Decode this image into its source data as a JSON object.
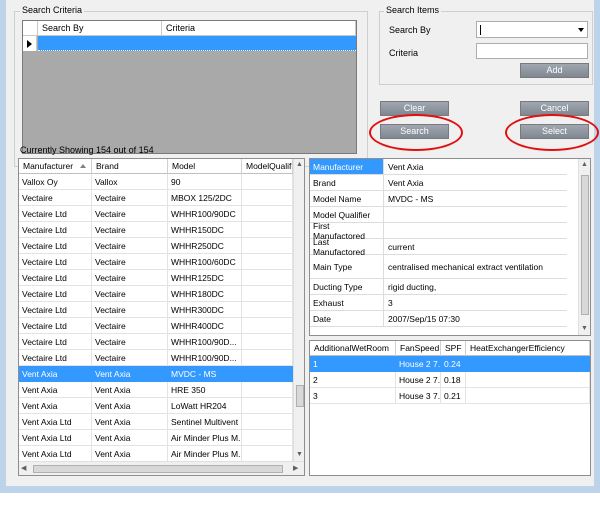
{
  "search_criteria": {
    "legend": "Search Criteria",
    "columns": [
      "Search By",
      "Criteria"
    ]
  },
  "search_items": {
    "legend": "Search Items",
    "search_by_label": "Search By",
    "criteria_label": "Criteria",
    "add_label": "Add"
  },
  "buttons": {
    "clear": "Clear",
    "cancel": "Cancel",
    "search": "Search",
    "select": "Select"
  },
  "status": "Currently Showing 154 out of 154",
  "list": {
    "columns": [
      "Manufacturer",
      "Brand",
      "Model",
      "ModelQualifie"
    ],
    "rows": [
      [
        "Vallox Oy",
        "Vallox",
        "90",
        ""
      ],
      [
        "Vectaire",
        "Vectaire",
        "MBOX 125/2DC",
        ""
      ],
      [
        "Vectaire Ltd",
        "Vectaire",
        "WHHR100/90DC",
        ""
      ],
      [
        "Vectaire Ltd",
        "Vectaire",
        "WHHR150DC",
        ""
      ],
      [
        "Vectaire Ltd",
        "Vectaire",
        "WHHR250DC",
        ""
      ],
      [
        "Vectaire Ltd",
        "Vectaire",
        "WHHR100/60DC",
        ""
      ],
      [
        "Vectaire Ltd",
        "Vectaire",
        "WHHR125DC",
        ""
      ],
      [
        "Vectaire Ltd",
        "Vectaire",
        "WHHR180DC",
        ""
      ],
      [
        "Vectaire Ltd",
        "Vectaire",
        "WHHR300DC",
        ""
      ],
      [
        "Vectaire Ltd",
        "Vectaire",
        "WHHR400DC",
        ""
      ],
      [
        "Vectaire Ltd",
        "Vectaire",
        "WHHR100/90D...",
        ""
      ],
      [
        "Vectaire Ltd",
        "Vectaire",
        "WHHR100/90D...",
        ""
      ],
      [
        "Vent Axia",
        "Vent Axia",
        "MVDC - MS",
        ""
      ],
      [
        "Vent Axia",
        "Vent Axia",
        "HRE 350",
        ""
      ],
      [
        "Vent Axia",
        "Vent Axia",
        "LoWatt HR204",
        ""
      ],
      [
        "Vent Axia Ltd",
        "Vent Axia",
        "Sentinel Multivent",
        ""
      ],
      [
        "Vent Axia Ltd",
        "Vent Axia",
        "Air Minder Plus M...",
        ""
      ],
      [
        "Vent Axia Ltd",
        "Vent Axia",
        "Air Minder Plus M...",
        ""
      ]
    ],
    "selected_index": 12
  },
  "details": [
    {
      "key": "Manufacturer",
      "value": "Vent Axia"
    },
    {
      "key": "Brand",
      "value": "Vent Axia"
    },
    {
      "key": "Model Name",
      "value": "MVDC - MS"
    },
    {
      "key": "Model Qualifier",
      "value": ""
    },
    {
      "key": "First Manufactored",
      "value": ""
    },
    {
      "key": "Last Manufactored",
      "value": "current"
    },
    {
      "key": "Main Type",
      "value": "centralised mechanical extract ventilation"
    },
    {
      "key": "Ducting Type",
      "value": "rigid ducting,"
    },
    {
      "key": "Exhaust",
      "value": "3"
    },
    {
      "key": "Date",
      "value": "2007/Sep/15 07:30"
    }
  ],
  "perf": {
    "columns": [
      "AdditionalWetRoom",
      "FanSpeed",
      "SPF",
      "HeatExchangerEfficiency"
    ],
    "rows": [
      [
        "1",
        "House 2 7...",
        "0.24",
        ""
      ],
      [
        "2",
        "House 2 7...",
        "0.18",
        ""
      ],
      [
        "3",
        "House 3 7...",
        "0.21",
        ""
      ]
    ],
    "selected_index": 0
  },
  "colors": {
    "selection": "#3399ff",
    "highlight_ring": "#e01010",
    "button": "#8a919a"
  },
  "icons": [
    "row-pointer-icon",
    "dropdown-arrow-icon",
    "sort-up-icon",
    "scroll-up-icon",
    "scroll-down-icon",
    "scroll-left-icon",
    "scroll-right-icon"
  ]
}
